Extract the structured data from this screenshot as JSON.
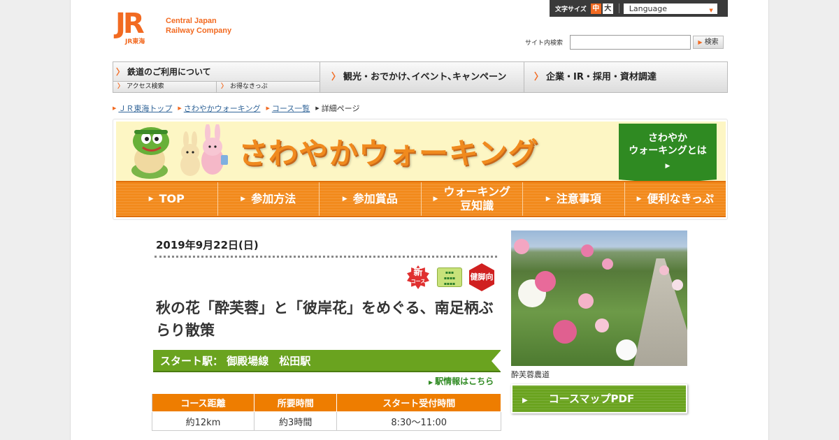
{
  "header": {
    "logo_mark": "JR",
    "logo_sub": "JR東海",
    "company_line1": "Central Japan",
    "company_line2": "Railway Company",
    "font_size_label": "文字サイズ",
    "font_size_mid": "中",
    "font_size_large": "大",
    "language_label": "Language",
    "search_label": "サイト内検索",
    "search_placeholder": "",
    "search_button": "検索"
  },
  "global_nav": {
    "item1": "鉄道のご利用について",
    "item1_sub1": "アクセス検索",
    "item1_sub2": "お得なきっぷ",
    "item2": "観光・おでかけ､イベント､キャンペーン",
    "item3": "企業・IR・採用・資材調達"
  },
  "breadcrumb": {
    "b1": "ＪＲ東海トップ",
    "b2": "さわやかウォーキング",
    "b3": "コース一覧",
    "b4": "詳細ページ"
  },
  "banner": {
    "title": "さわやかウォーキング",
    "about_line1": "さわやか",
    "about_line2": "ウォーキングとは",
    "nav": [
      "TOP",
      "参加方法",
      "参加賞品",
      "ウォーキング\n豆知識",
      "注意事項",
      "便利なきっぷ"
    ]
  },
  "event": {
    "date": "2019年9月22日(日)",
    "badge_new": "新",
    "badge_new_sub": "コース",
    "badge_ken": "健脚向",
    "title": "秋の花「酔芙蓉」と「彼岸花」をめぐる、南足柄ぶらり散策",
    "start_station": "スタート駅： 御殿場線　松田駅",
    "station_link": "駅情報はこちら",
    "table_headers": [
      "コース距離",
      "所要時間",
      "スタート受付時間"
    ],
    "table_values": [
      "約12km",
      "約3時間",
      "8:30～11:00"
    ],
    "photo_caption": "酔芙蓉農道",
    "map_button": "コースマップPDF"
  },
  "colors": {
    "brand_orange": "#f26a21",
    "nav_orange": "#f28a1c",
    "green": "#6aa31f"
  }
}
